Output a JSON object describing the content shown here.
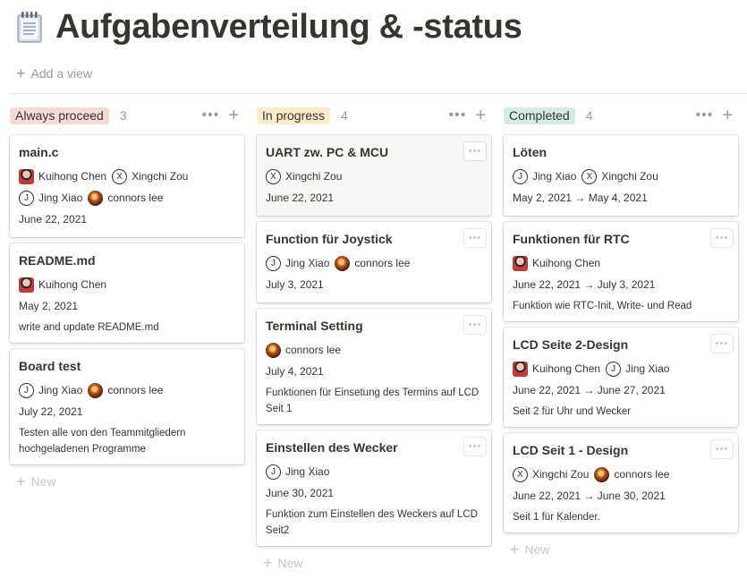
{
  "page": {
    "icon": "notepad-icon",
    "title": "Aufgabenverteilung & -status",
    "add_view_label": "Add a view"
  },
  "board": {
    "new_label": "New",
    "columns": [
      {
        "name": "Always proceed",
        "count": "3",
        "color": "#f2dcd7",
        "cards": [
          {
            "title": "main.c",
            "people": [
              {
                "name": "Kuihong Chen",
                "avatar": "photo-k"
              },
              {
                "name": "Xingchi Zou",
                "avatar": "X"
              },
              {
                "name": "Jing Xiao",
                "avatar": "J"
              },
              {
                "name": "connors lee",
                "avatar": "photo-c"
              }
            ],
            "date": "June 22, 2021",
            "desc": ""
          },
          {
            "title": "README.md",
            "people": [
              {
                "name": "Kuihong Chen",
                "avatar": "photo-k"
              }
            ],
            "date": "May 2, 2021",
            "desc": "write and update README.md"
          },
          {
            "title": "Board test",
            "people": [
              {
                "name": "Jing Xiao",
                "avatar": "J"
              },
              {
                "name": "connors lee",
                "avatar": "photo-c"
              }
            ],
            "date": "July 22, 2021",
            "desc": "Testen alle von den Teammitgliedern hochgeladenen Programme"
          }
        ]
      },
      {
        "name": "In progress",
        "count": "4",
        "color": "#fbeccc",
        "cards": [
          {
            "title": "UART zw. PC & MCU",
            "people": [
              {
                "name": "Xingchi Zou",
                "avatar": "X"
              }
            ],
            "date": "June 22, 2021",
            "desc": "",
            "hover": true
          },
          {
            "title": "Function für Joystick",
            "people": [
              {
                "name": "Jing Xiao",
                "avatar": "J"
              },
              {
                "name": "connors lee",
                "avatar": "photo-c"
              }
            ],
            "date": "July 3, 2021",
            "desc": ""
          },
          {
            "title": "Terminal Setting",
            "people": [
              {
                "name": "connors lee",
                "avatar": "photo-c"
              }
            ],
            "date": "July 4, 2021",
            "desc": "Funktionen für Einsetung des Termins auf LCD Seit 1"
          },
          {
            "title": "Einstellen des Wecker",
            "people": [
              {
                "name": "Jing Xiao",
                "avatar": "J"
              }
            ],
            "date": "June 30, 2021",
            "desc": "Funktion zum Einstellen des Weckers auf LCD Seit2"
          }
        ]
      },
      {
        "name": "Completed",
        "count": "4",
        "color": "#d4ece5",
        "cards": [
          {
            "title": "Löten",
            "people": [
              {
                "name": "Jing Xiao",
                "avatar": "J"
              },
              {
                "name": "Xingchi Zou",
                "avatar": "X"
              }
            ],
            "date": "May 2, 2021 → May 4, 2021",
            "desc": ""
          },
          {
            "title": "Funktionen für RTC",
            "people": [
              {
                "name": "Kuihong Chen",
                "avatar": "photo-k"
              }
            ],
            "date": "June 22, 2021 → July 3, 2021",
            "desc": "Funktion wie RTC-Init, Write- und  Read"
          },
          {
            "title": "LCD Seite 2-Design",
            "people": [
              {
                "name": "Kuihong Chen",
                "avatar": "photo-k"
              },
              {
                "name": "Jing Xiao",
                "avatar": "J"
              }
            ],
            "date": "June 22, 2021 → June 27, 2021",
            "desc": "Seit 2 für Uhr und Wecker"
          },
          {
            "title": "LCD Seit 1 - Design",
            "people": [
              {
                "name": "Xingchi Zou",
                "avatar": "X"
              },
              {
                "name": "connors lee",
                "avatar": "photo-c"
              }
            ],
            "date": "June 22, 2021 → June 30, 2021",
            "desc": "Seit 1 für Kalender."
          }
        ]
      }
    ]
  }
}
